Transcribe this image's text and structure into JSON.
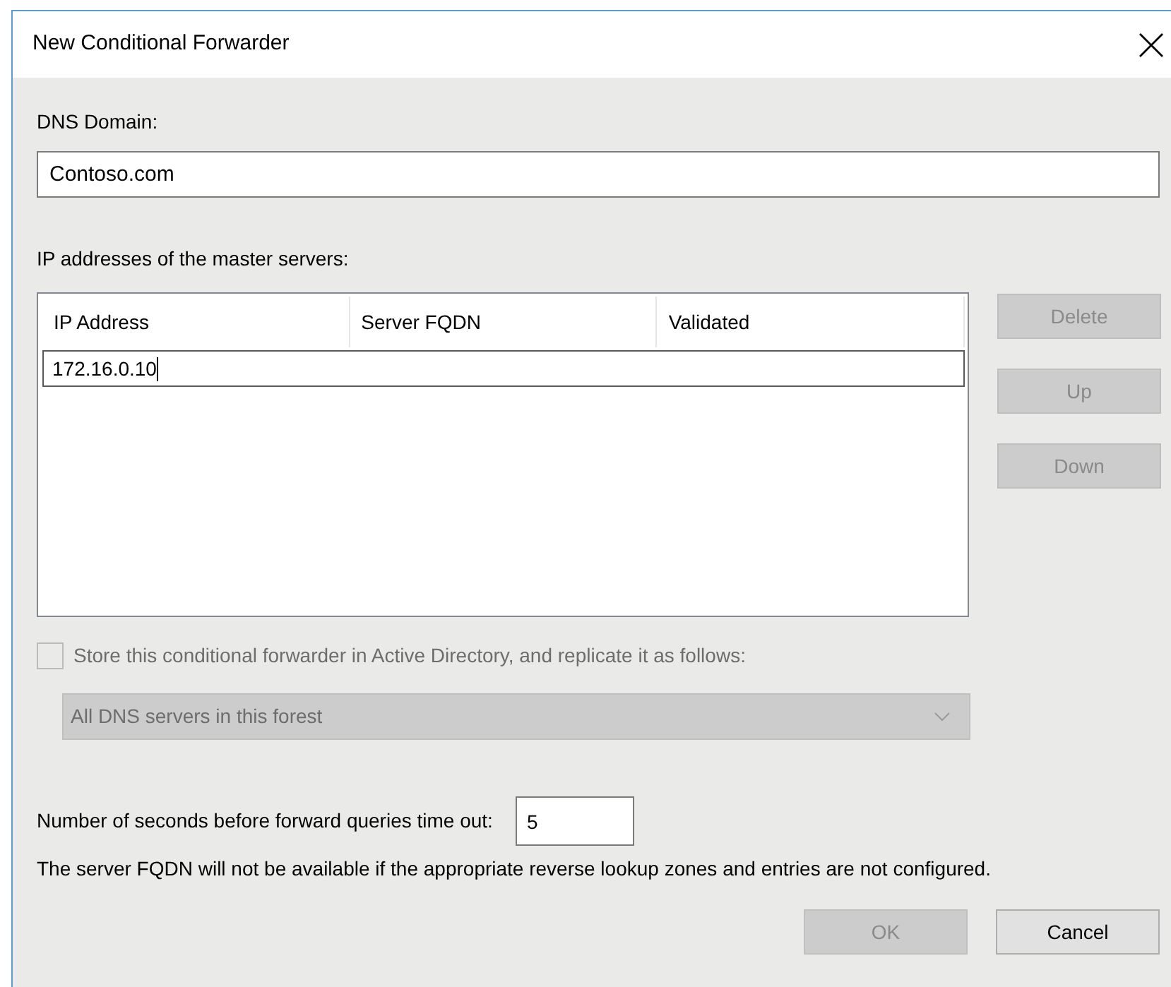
{
  "window": {
    "title": "New Conditional Forwarder"
  },
  "dns_domain": {
    "label": "DNS Domain:",
    "value": "Contoso.com"
  },
  "master_servers": {
    "label": "IP addresses of the master servers:",
    "columns": [
      "IP Address",
      "Server FQDN",
      "Validated"
    ],
    "rows": [
      {
        "ip_address": "172.16.0.10",
        "editing": true
      }
    ],
    "buttons": [
      {
        "label": "Delete",
        "disabled": true
      },
      {
        "label": "Up",
        "disabled": true
      },
      {
        "label": "Down",
        "disabled": true
      }
    ]
  },
  "store_in_ad": {
    "label": "Store this conditional forwarder in Active Directory, and replicate it as follows:",
    "checked": false,
    "disabled": true
  },
  "replication": {
    "value": "All DNS servers in this forest",
    "disabled": true
  },
  "timeout": {
    "label": "Number of seconds before forward queries time out:",
    "value": "5"
  },
  "note": "The server FQDN will not be available if the appropriate reverse lookup zones and entries are not configured.",
  "buttons": [
    {
      "label": "OK",
      "disabled": true
    },
    {
      "label": "Cancel",
      "disabled": false
    }
  ]
}
